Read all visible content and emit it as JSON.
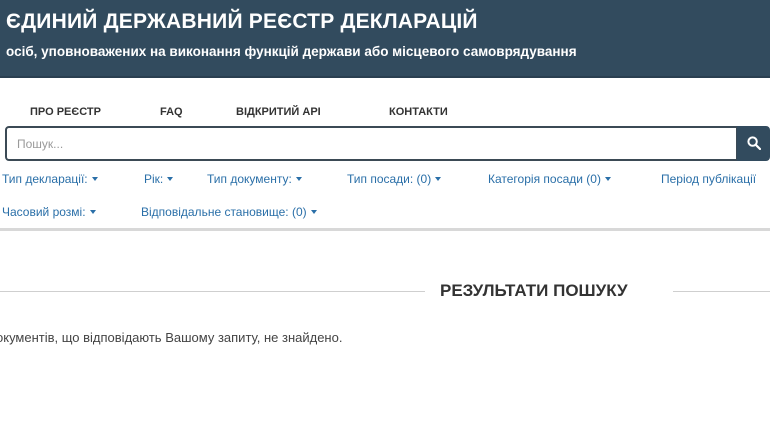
{
  "header": {
    "title": "ЄДИНИЙ ДЕРЖАВНИЙ РЕЄСТР ДЕКЛАРАЦІЙ",
    "subtitle": "осіб, уповноважених на виконання функцій держави або місцевого самоврядування"
  },
  "nav": {
    "items": [
      {
        "label": "ПРО РЕЄСТР"
      },
      {
        "label": "FAQ"
      },
      {
        "label": "ВІДКРИТИЙ API"
      },
      {
        "label": "КОНТАКТИ"
      }
    ]
  },
  "search": {
    "placeholder": "Пошук...",
    "value": "",
    "button_icon": "search-icon"
  },
  "filters": {
    "items": [
      {
        "label": "Тип декларації:"
      },
      {
        "label": "Рік:"
      },
      {
        "label": "Тип документу:"
      },
      {
        "label": "Тип посади: (0)"
      },
      {
        "label": "Категорія посади (0)"
      },
      {
        "label": "Період публікації"
      },
      {
        "label": "Часовий розмі:"
      },
      {
        "label": "Відповідальне становище: (0)"
      }
    ]
  },
  "results": {
    "title": "РЕЗУЛЬТАТИ ПОШУКУ",
    "message": "окументів, що відповідають Вашому запиту, не знайдено."
  },
  "colors": {
    "header_bg": "#324b5e",
    "filter_link": "#2a6fa8",
    "search_button": "#324b5e"
  }
}
